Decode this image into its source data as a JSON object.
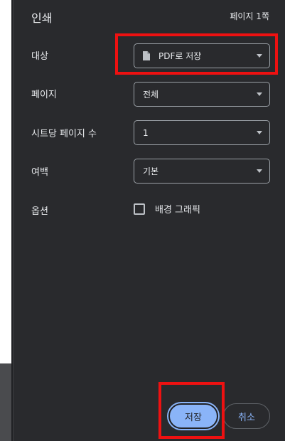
{
  "header": {
    "title": "인쇄",
    "page_count": "페이지 1쪽"
  },
  "settings": {
    "destination": {
      "label": "대상",
      "value": "PDF로 저장"
    },
    "pages": {
      "label": "페이지",
      "value": "전체"
    },
    "pages_per_sheet": {
      "label": "시트당 페이지 수",
      "value": "1"
    },
    "margins": {
      "label": "여백",
      "value": "기본"
    },
    "options": {
      "label": "옵션",
      "background_graphics": "배경 그래픽",
      "background_graphics_checked": false
    }
  },
  "actions": {
    "save_label": "저장",
    "cancel_label": "취소"
  },
  "colors": {
    "panel_bg": "#292a2d",
    "accent": "#8ab4f8",
    "highlight": "#ee1111"
  }
}
